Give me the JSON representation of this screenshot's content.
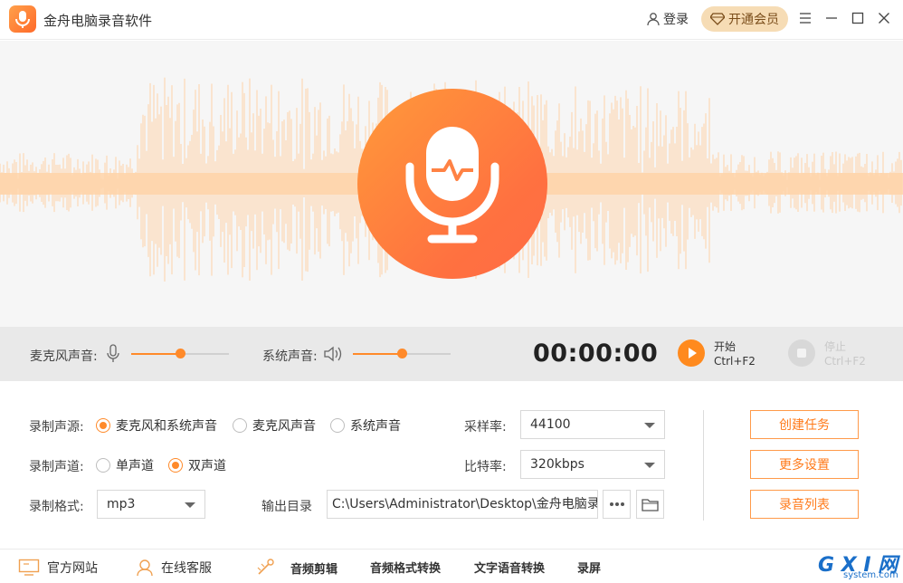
{
  "app": {
    "title": "金舟电脑录音软件",
    "login": "登录",
    "vip": "开通会员"
  },
  "colors": {
    "accent": "#ff8a2a",
    "wave": "#ffd3a8",
    "vip_bg": "#f6dcb5"
  },
  "controls": {
    "mic_label": "麦克风声音:",
    "mic_level": 0.5,
    "system_label": "系统声音:",
    "system_level": 0.5,
    "timer": "00:00:00",
    "start": {
      "label": "开始",
      "hotkey": "Ctrl+F2"
    },
    "stop": {
      "label": "停止",
      "hotkey": "Ctrl+F2"
    }
  },
  "settings": {
    "source": {
      "label": "录制声源:",
      "options": [
        "麦克风和系统声音",
        "麦克风声音",
        "系统声音"
      ],
      "selected": 0
    },
    "channel": {
      "label": "录制声道:",
      "options": [
        "单声道",
        "双声道"
      ],
      "selected": 1
    },
    "format": {
      "label": "录制格式:",
      "value": "mp3"
    },
    "sample_rate": {
      "label": "采样率:",
      "value": "44100"
    },
    "bitrate": {
      "label": "比特率:",
      "value": "320kbps"
    },
    "output": {
      "label": "输出目录",
      "path": "C:\\Users\\Administrator\\Desktop\\金舟电脑录"
    },
    "buttons": {
      "create": "创建任务",
      "more": "更多设置",
      "list": "录音列表"
    }
  },
  "bottom": {
    "website": "官方网站",
    "support": "在线客服",
    "tools": [
      "音频剪辑",
      "音频格式转换",
      "文字语音转换",
      "录屏"
    ]
  },
  "watermark": {
    "main": "G X I 网",
    "sub": "system.com"
  }
}
